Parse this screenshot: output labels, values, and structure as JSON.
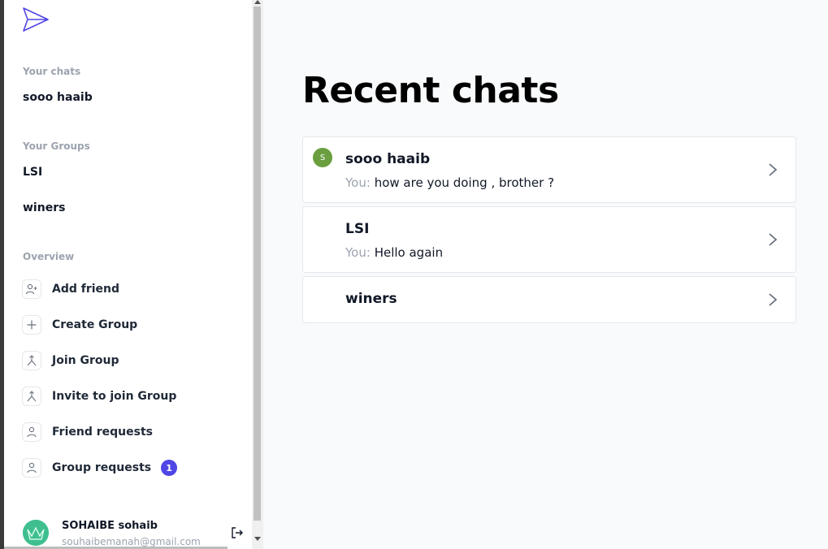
{
  "sidebar": {
    "your_chats_label": "Your chats",
    "chats": [
      {
        "name": "sooo haaib"
      }
    ],
    "your_groups_label": "Your Groups",
    "groups": [
      {
        "name": "LSI"
      },
      {
        "name": "winers"
      }
    ],
    "overview_label": "Overview",
    "overview_items": [
      {
        "label": "Add friend",
        "icon": "user-plus-icon"
      },
      {
        "label": "Create Group",
        "icon": "plus-icon"
      },
      {
        "label": "Join Group",
        "icon": "merge-icon"
      },
      {
        "label": "Invite to join Group",
        "icon": "merge-icon"
      },
      {
        "label": "Friend requests",
        "icon": "user-icon"
      },
      {
        "label": "Group requests",
        "icon": "user-icon",
        "badge": "1"
      }
    ],
    "profile": {
      "name": "SOHAIBE sohaib",
      "email": "souhaibemanah@gmail.com"
    }
  },
  "main": {
    "title": "Recent chats",
    "chats": [
      {
        "name": "sooo haaib",
        "avatar_letter": "S",
        "you_prefix": "You:",
        "message": "how are you doing , brother ?"
      },
      {
        "name": "LSI",
        "you_prefix": "You:",
        "message": "Hello again"
      },
      {
        "name": "winers"
      }
    ]
  },
  "colors": {
    "accent": "#4f46e5",
    "badge": "#4f46e5",
    "avatar_green": "#6a9e3f",
    "background": "#f9fafb"
  }
}
